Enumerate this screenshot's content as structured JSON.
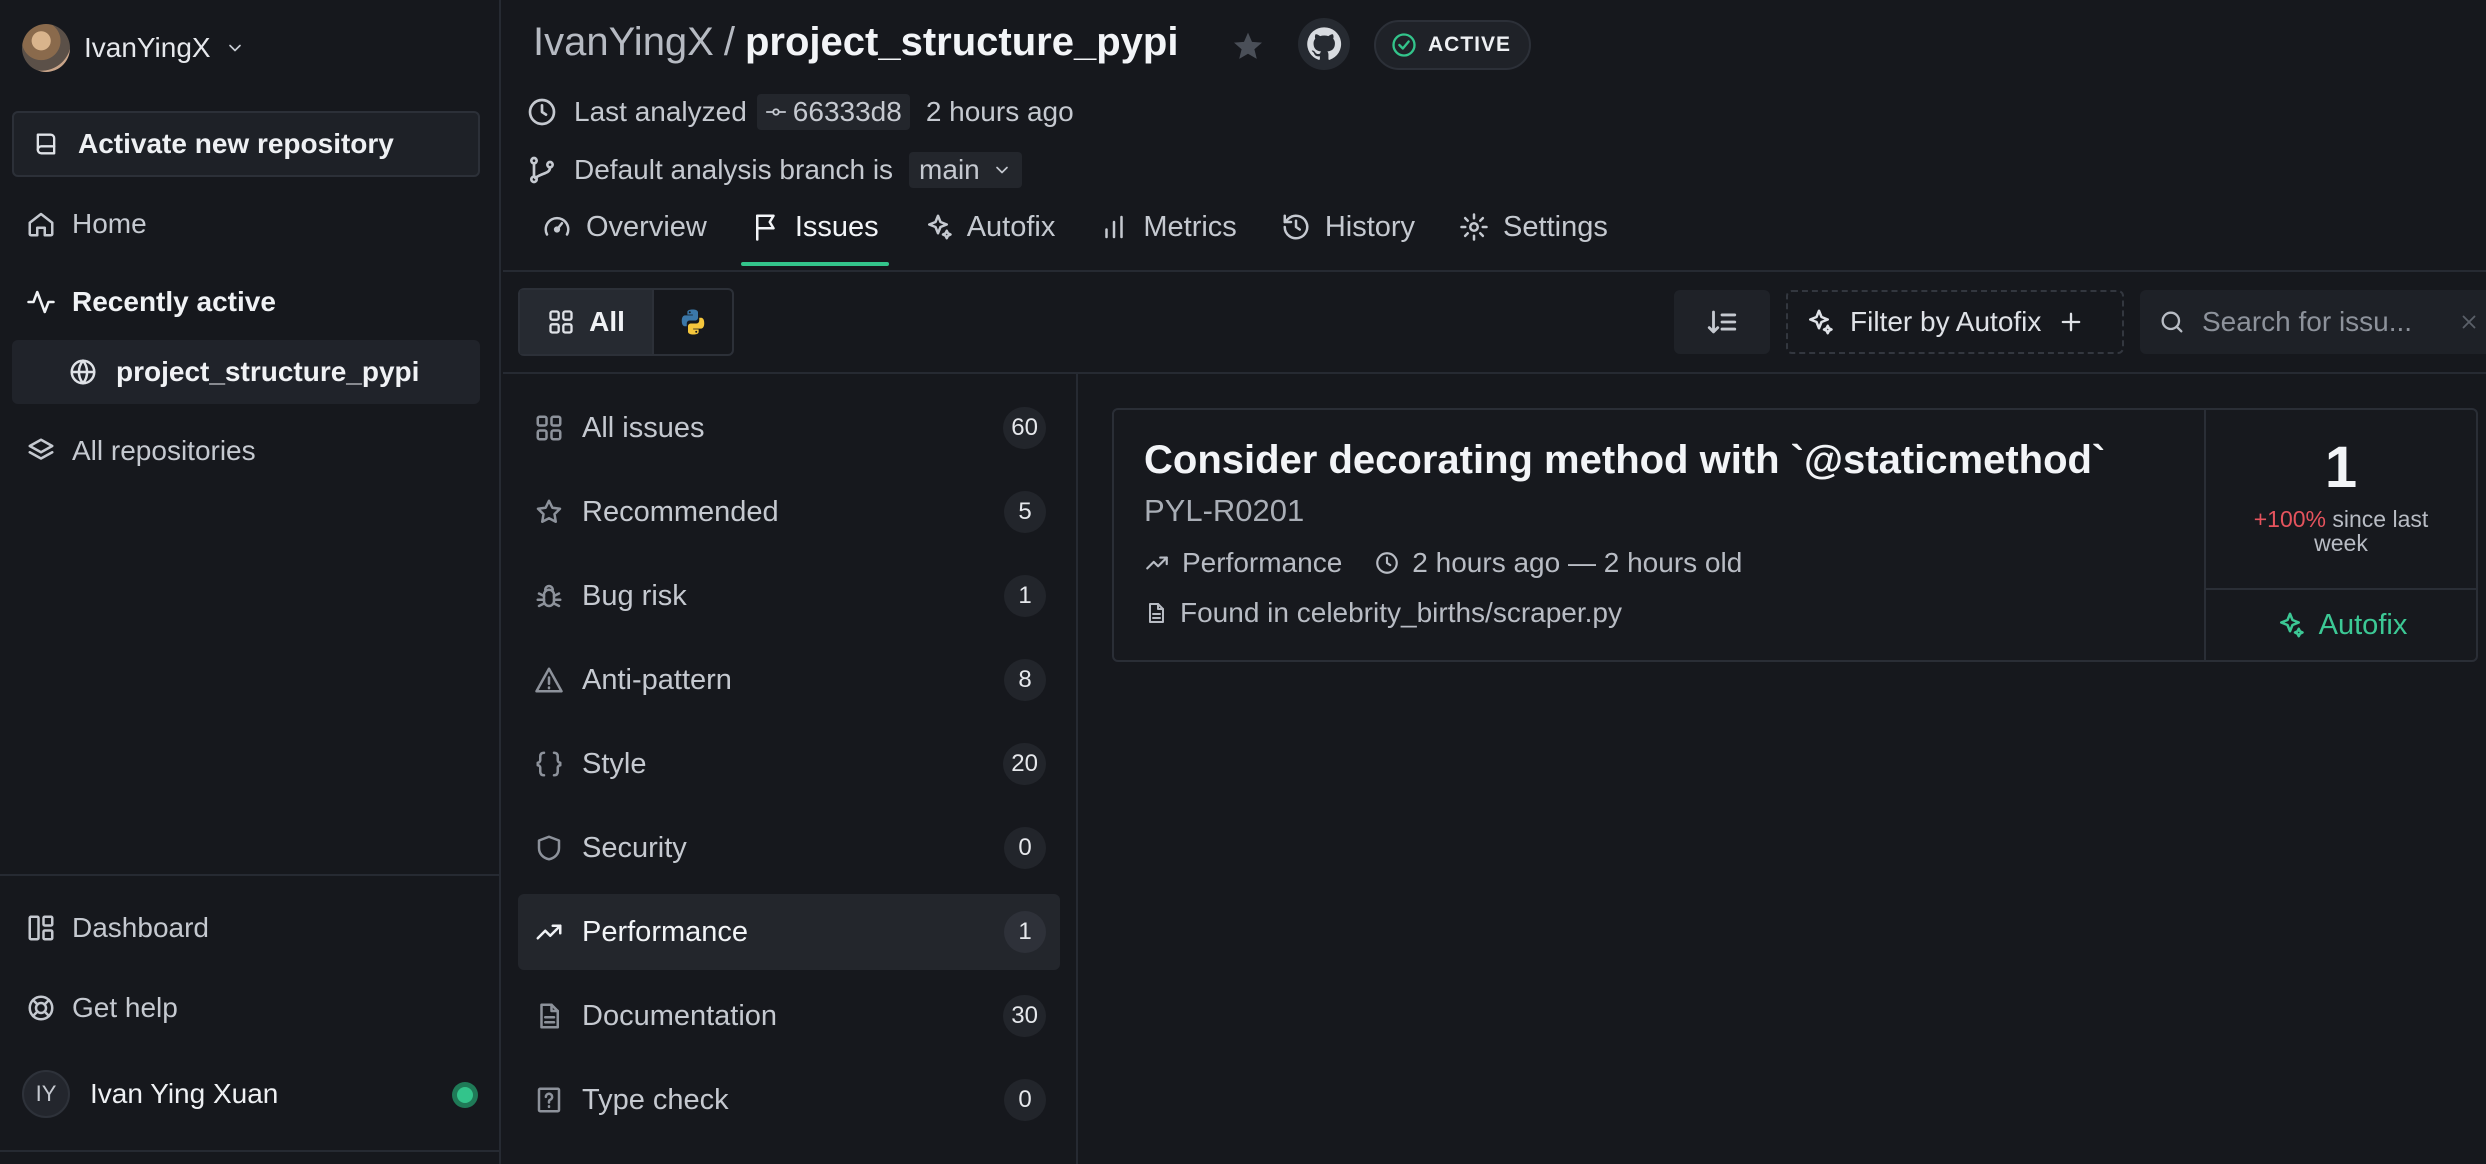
{
  "sidebar": {
    "username": "IvanYingX",
    "activate_label": "Activate new repository",
    "home_label": "Home",
    "recently_active_label": "Recently active",
    "recent_repo": "project_structure_pypi",
    "all_repos_label": "All repositories",
    "dashboard_label": "Dashboard",
    "help_label": "Get help",
    "profile_initials": "IY",
    "profile_name": "Ivan Ying Xuan"
  },
  "header": {
    "owner": "IvanYingX",
    "separator": "/",
    "repo": "project_structure_pypi",
    "status": "ACTIVE",
    "last_analyzed_label": "Last analyzed",
    "commit": "66333d8",
    "time_ago": "2 hours ago",
    "branch_label": "Default analysis branch is",
    "branch": "main"
  },
  "tabs": [
    {
      "label": "Overview",
      "icon": "gauge-icon"
    },
    {
      "label": "Issues",
      "icon": "flag-icon"
    },
    {
      "label": "Autofix",
      "icon": "sparkle-icon"
    },
    {
      "label": "Metrics",
      "icon": "bar-chart-icon"
    },
    {
      "label": "History",
      "icon": "history-icon"
    },
    {
      "label": "Settings",
      "icon": "gear-icon"
    }
  ],
  "active_tab": "Issues",
  "toolbar": {
    "all_label": "All",
    "filter_label": "Filter by Autofix",
    "search_placeholder": "Search for issu..."
  },
  "categories": [
    {
      "label": "All issues",
      "count": "60"
    },
    {
      "label": "Recommended",
      "count": "5"
    },
    {
      "label": "Bug risk",
      "count": "1"
    },
    {
      "label": "Anti-pattern",
      "count": "8"
    },
    {
      "label": "Style",
      "count": "20"
    },
    {
      "label": "Security",
      "count": "0"
    },
    {
      "label": "Performance",
      "count": "1"
    },
    {
      "label": "Documentation",
      "count": "30"
    },
    {
      "label": "Type check",
      "count": "0"
    }
  ],
  "active_category": "Performance",
  "issue": {
    "title": "Consider decorating method with `@staticmethod`",
    "code": "PYL-R0201",
    "category": "Performance",
    "age": "2 hours ago — 2 hours old",
    "found_in": "Found in celebrity_births/scraper.py",
    "occurrences": "1",
    "trend_pct": "+100%",
    "trend_text": "since last week",
    "autofix_label": "Autofix"
  },
  "colors": {
    "accent": "#33c48b",
    "trend_up": "#e5535d",
    "background": "#16181d"
  }
}
